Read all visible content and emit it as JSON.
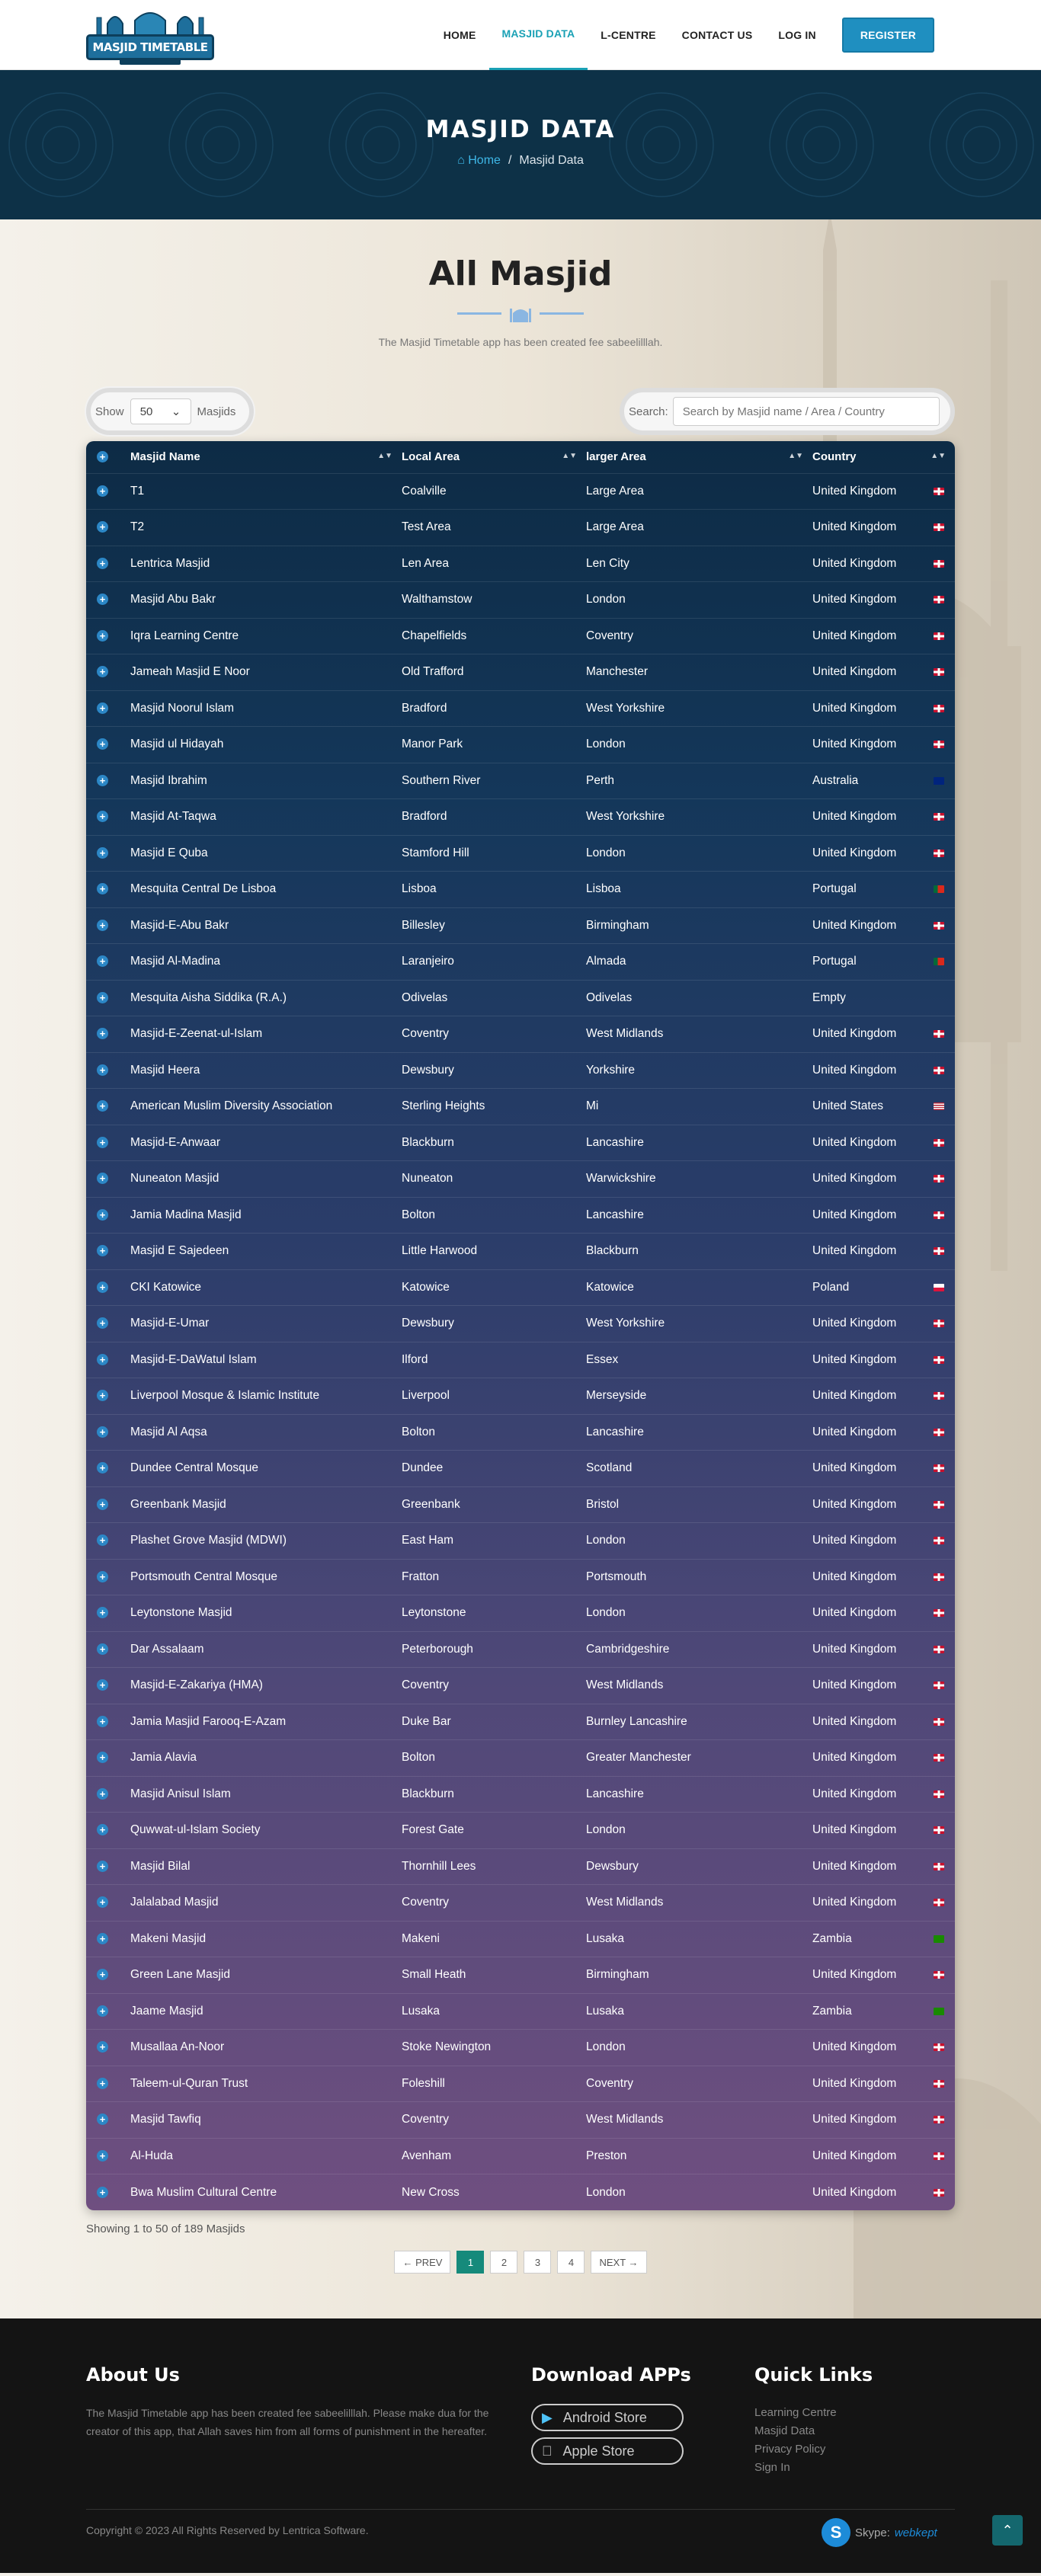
{
  "header": {
    "logo_text": "MASJID TIMETABLE",
    "nav": [
      {
        "label": "HOME",
        "active": false
      },
      {
        "label": "MASJID DATA",
        "active": true
      },
      {
        "label": "L-CENTRE",
        "active": false
      },
      {
        "label": "CONTACT US",
        "active": false
      },
      {
        "label": "LOG IN",
        "active": false
      }
    ],
    "register_label": "REGISTER"
  },
  "hero": {
    "title": "MASJID DATA",
    "breadcrumb_home": "Home",
    "breadcrumb_sep": "/",
    "breadcrumb_current": "Masjid Data"
  },
  "main": {
    "title": "All Masjid",
    "subtitle": "The Masjid Timetable app has been created fee sabeelilllah.",
    "show_label": "Show",
    "show_value": "50",
    "show_suffix": "Masjids",
    "search_label": "Search:",
    "search_placeholder": "Search by Masjid name / Area / Country",
    "columns": [
      "Masjid Name",
      "Local Area",
      "larger Area",
      "Country"
    ],
    "rows": [
      {
        "name": "T1",
        "local": "Coalville",
        "larger": "Large Area",
        "country": "United Kingdom",
        "flag": "uk"
      },
      {
        "name": "T2",
        "local": "Test Area",
        "larger": "Large Area",
        "country": "United Kingdom",
        "flag": "uk"
      },
      {
        "name": "Lentrica Masjid",
        "local": "Len Area",
        "larger": "Len City",
        "country": "United Kingdom",
        "flag": "uk"
      },
      {
        "name": "Masjid Abu Bakr",
        "local": "Walthamstow",
        "larger": "London",
        "country": "United Kingdom",
        "flag": "uk"
      },
      {
        "name": "Iqra Learning Centre",
        "local": "Chapelfields",
        "larger": "Coventry",
        "country": "United Kingdom",
        "flag": "uk"
      },
      {
        "name": "Jameah Masjid E Noor",
        "local": "Old Trafford",
        "larger": "Manchester",
        "country": "United Kingdom",
        "flag": "uk"
      },
      {
        "name": "Masjid Noorul Islam",
        "local": "Bradford",
        "larger": "West Yorkshire",
        "country": "United Kingdom",
        "flag": "uk"
      },
      {
        "name": "Masjid ul Hidayah",
        "local": "Manor Park",
        "larger": "London",
        "country": "United Kingdom",
        "flag": "uk"
      },
      {
        "name": "Masjid Ibrahim",
        "local": "Southern River",
        "larger": "Perth",
        "country": "Australia",
        "flag": "au"
      },
      {
        "name": "Masjid At-Taqwa",
        "local": "Bradford",
        "larger": "West Yorkshire",
        "country": "United Kingdom",
        "flag": "uk"
      },
      {
        "name": "Masjid E Quba",
        "local": "Stamford Hill",
        "larger": "London",
        "country": "United Kingdom",
        "flag": "uk"
      },
      {
        "name": "Mesquita Central De Lisboa",
        "local": "Lisboa",
        "larger": "Lisboa",
        "country": "Portugal",
        "flag": "pt"
      },
      {
        "name": "Masjid-E-Abu Bakr",
        "local": "Billesley",
        "larger": "Birmingham",
        "country": "United Kingdom",
        "flag": "uk"
      },
      {
        "name": "Masjid Al-Madina",
        "local": "Laranjeiro",
        "larger": "Almada",
        "country": "Portugal",
        "flag": "pt"
      },
      {
        "name": "Mesquita Aisha Siddika (R.A.)",
        "local": "Odivelas",
        "larger": "Odivelas",
        "country": "Empty",
        "flag": ""
      },
      {
        "name": "Masjid-E-Zeenat-ul-Islam",
        "local": "Coventry",
        "larger": "West Midlands",
        "country": "United Kingdom",
        "flag": "uk"
      },
      {
        "name": "Masjid Heera",
        "local": "Dewsbury",
        "larger": "Yorkshire",
        "country": "United Kingdom",
        "flag": "uk"
      },
      {
        "name": "American Muslim Diversity Association",
        "local": "Sterling Heights",
        "larger": "Mi",
        "country": "United States",
        "flag": "us"
      },
      {
        "name": "Masjid-E-Anwaar",
        "local": "Blackburn",
        "larger": "Lancashire",
        "country": "United Kingdom",
        "flag": "uk"
      },
      {
        "name": "Nuneaton Masjid",
        "local": "Nuneaton",
        "larger": "Warwickshire",
        "country": "United Kingdom",
        "flag": "uk"
      },
      {
        "name": "Jamia Madina Masjid",
        "local": "Bolton",
        "larger": "Lancashire",
        "country": "United Kingdom",
        "flag": "uk"
      },
      {
        "name": "Masjid E Sajedeen",
        "local": "Little Harwood",
        "larger": "Blackburn",
        "country": "United Kingdom",
        "flag": "uk"
      },
      {
        "name": "CKI Katowice",
        "local": "Katowice",
        "larger": "Katowice",
        "country": "Poland",
        "flag": "pl"
      },
      {
        "name": "Masjid-E-Umar",
        "local": "Dewsbury",
        "larger": "West Yorkshire",
        "country": "United Kingdom",
        "flag": "uk"
      },
      {
        "name": "Masjid-E-DaWatul Islam",
        "local": "Ilford",
        "larger": "Essex",
        "country": "United Kingdom",
        "flag": "uk"
      },
      {
        "name": "Liverpool Mosque & Islamic Institute",
        "local": "Liverpool",
        "larger": "Merseyside",
        "country": "United Kingdom",
        "flag": "uk"
      },
      {
        "name": "Masjid Al Aqsa",
        "local": "Bolton",
        "larger": "Lancashire",
        "country": "United Kingdom",
        "flag": "uk"
      },
      {
        "name": "Dundee Central Mosque",
        "local": "Dundee",
        "larger": "Scotland",
        "country": "United Kingdom",
        "flag": "uk"
      },
      {
        "name": "Greenbank Masjid",
        "local": "Greenbank",
        "larger": "Bristol",
        "country": "United Kingdom",
        "flag": "uk"
      },
      {
        "name": "Plashet Grove Masjid (MDWI)",
        "local": "East Ham",
        "larger": "London",
        "country": "United Kingdom",
        "flag": "uk"
      },
      {
        "name": "Portsmouth Central Mosque",
        "local": "Fratton",
        "larger": "Portsmouth",
        "country": "United Kingdom",
        "flag": "uk"
      },
      {
        "name": "Leytonstone Masjid",
        "local": "Leytonstone",
        "larger": "London",
        "country": "United Kingdom",
        "flag": "uk"
      },
      {
        "name": "Dar Assalaam",
        "local": "Peterborough",
        "larger": "Cambridgeshire",
        "country": "United Kingdom",
        "flag": "uk"
      },
      {
        "name": "Masjid-E-Zakariya (HMA)",
        "local": "Coventry",
        "larger": "West Midlands",
        "country": "United Kingdom",
        "flag": "uk"
      },
      {
        "name": "Jamia Masjid Farooq-E-Azam",
        "local": "Duke Bar",
        "larger": "Burnley Lancashire",
        "country": "United Kingdom",
        "flag": "uk"
      },
      {
        "name": "Jamia Alavia",
        "local": "Bolton",
        "larger": "Greater Manchester",
        "country": "United Kingdom",
        "flag": "uk"
      },
      {
        "name": "Masjid Anisul Islam",
        "local": "Blackburn",
        "larger": "Lancashire",
        "country": "United Kingdom",
        "flag": "uk"
      },
      {
        "name": "Quwwat-ul-Islam Society",
        "local": "Forest Gate",
        "larger": "London",
        "country": "United Kingdom",
        "flag": "uk"
      },
      {
        "name": "Masjid Bilal",
        "local": "Thornhill Lees",
        "larger": "Dewsbury",
        "country": "United Kingdom",
        "flag": "uk"
      },
      {
        "name": "Jalalabad Masjid",
        "local": "Coventry",
        "larger": "West Midlands",
        "country": "United Kingdom",
        "flag": "uk"
      },
      {
        "name": "Makeni Masjid",
        "local": "Makeni",
        "larger": "Lusaka",
        "country": "Zambia",
        "flag": "zm"
      },
      {
        "name": "Green Lane Masjid",
        "local": "Small Heath",
        "larger": "Birmingham",
        "country": "United Kingdom",
        "flag": "uk"
      },
      {
        "name": "Jaame Masjid",
        "local": "Lusaka",
        "larger": "Lusaka",
        "country": "Zambia",
        "flag": "zm"
      },
      {
        "name": "Musallaa An-Noor",
        "local": "Stoke Newington",
        "larger": "London",
        "country": "United Kingdom",
        "flag": "uk"
      },
      {
        "name": "Taleem-ul-Quran Trust",
        "local": "Foleshill",
        "larger": "Coventry",
        "country": "United Kingdom",
        "flag": "uk"
      },
      {
        "name": "Masjid Tawfiq",
        "local": "Coventry",
        "larger": "West Midlands",
        "country": "United Kingdom",
        "flag": "uk"
      },
      {
        "name": "Al-Huda",
        "local": "Avenham",
        "larger": "Preston",
        "country": "United Kingdom",
        "flag": "uk"
      },
      {
        "name": "Bwa Muslim Cultural Centre",
        "local": "New Cross",
        "larger": "London",
        "country": "United Kingdom",
        "flag": "uk"
      }
    ],
    "info": "Showing 1 to 50 of 189 Masjids",
    "pager": {
      "prev": "← PREV",
      "pages": [
        "1",
        "2",
        "3",
        "4"
      ],
      "active": "1",
      "next": "NEXT →"
    }
  },
  "footer": {
    "about_title": "About Us",
    "about_text": "The Masjid Timetable app has been created fee sabeelilllah. Please make dua for the creator of this app, that Allah saves him from all forms of punishment in the hereafter.",
    "download_title": "Download APPs",
    "android_label": "Android Store",
    "apple_label": "Apple Store",
    "links_title": "Quick Links",
    "links": [
      "Learning Centre",
      "Masjid Data",
      "Privacy Policy",
      "Sign In"
    ],
    "copyright": "Copyright © 2023 All Rights Reserved by Lentrica Software.",
    "skype_label": "Skype:",
    "skype_handle": "webkept"
  },
  "colors": {
    "accent": "#1aa1b5",
    "hero": "#0d3147",
    "register": "#1f8fc0",
    "pager_active": "#168a7b"
  }
}
